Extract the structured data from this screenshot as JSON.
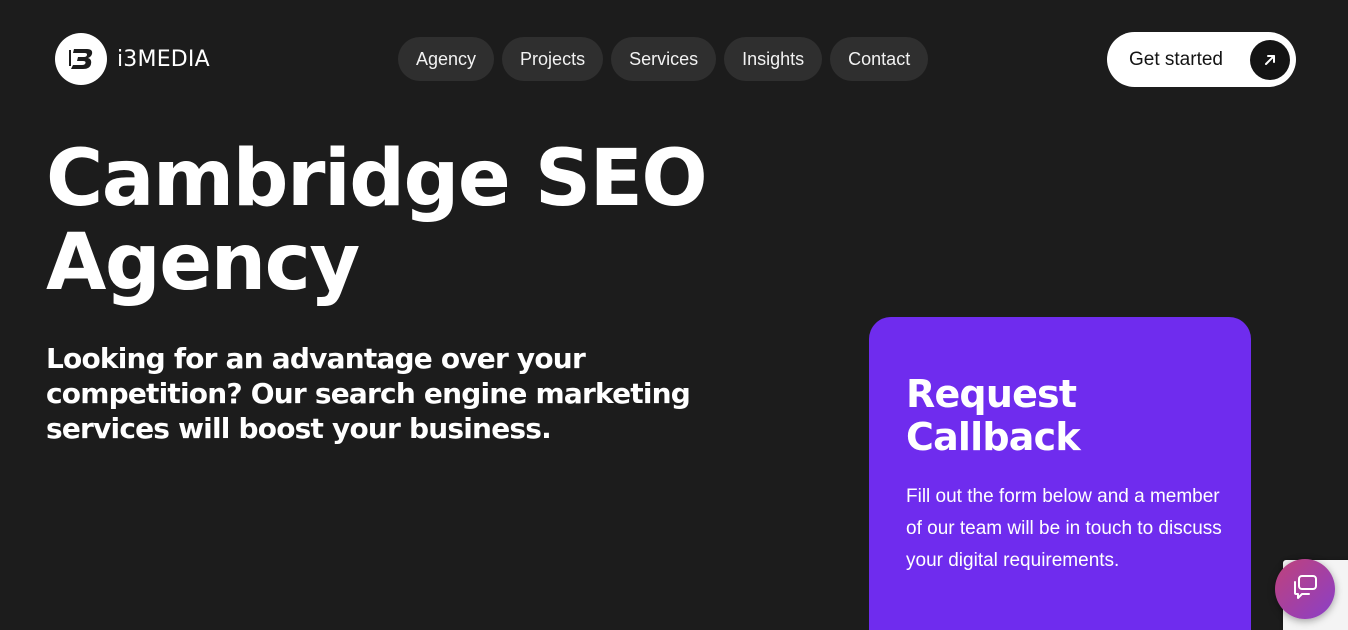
{
  "brand": {
    "name": "i3MEDIA",
    "logo_icon": "i3-logo-icon"
  },
  "nav": {
    "items": [
      {
        "label": "Agency"
      },
      {
        "label": "Projects"
      },
      {
        "label": "Services"
      },
      {
        "label": "Insights"
      },
      {
        "label": "Contact"
      }
    ]
  },
  "cta": {
    "label": "Get started",
    "icon": "arrow-up-right-icon"
  },
  "hero": {
    "title_line1": "Cambridge SEO",
    "title_line2": "Agency",
    "subtitle": "Looking for an advantage over your competition? Our search engine marketing services will boost your business."
  },
  "callback": {
    "title": "Request Callback",
    "text": "Fill out the form below and a member of our team will be in touch to discuss your digital requirements."
  },
  "chat": {
    "icon": "chat-bubbles-icon"
  },
  "colors": {
    "background": "#1c1c1c",
    "nav_pill": "#2f2f2f",
    "card_accent": "#6f2cee",
    "cta_bg": "#ffffff"
  }
}
